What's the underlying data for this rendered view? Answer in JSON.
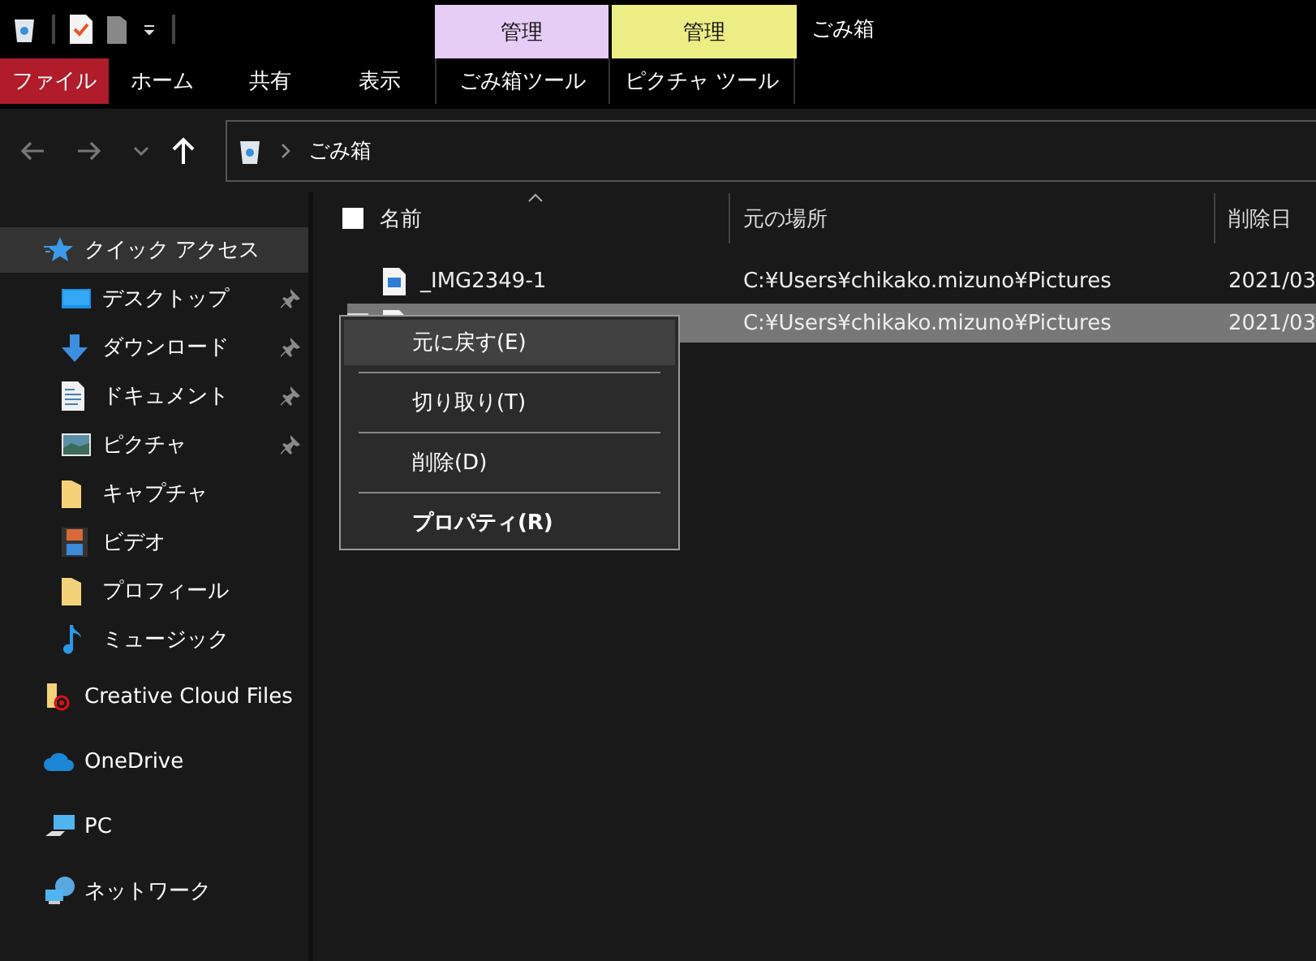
{
  "window": {
    "title": "ごみ箱"
  },
  "context_tabs": [
    {
      "label": "管理",
      "color": "#e6cdf5"
    },
    {
      "label": "管理",
      "color": "#eded86"
    }
  ],
  "ribbon_tabs": [
    {
      "label": "ファイル",
      "kind": "file"
    },
    {
      "label": "ホーム",
      "kind": "tab"
    },
    {
      "label": "共有",
      "kind": "tab"
    },
    {
      "label": "表示",
      "kind": "tab"
    },
    {
      "label": "ごみ箱ツール",
      "kind": "context"
    },
    {
      "label": "ピクチャ ツール",
      "kind": "context"
    }
  ],
  "address_bar": {
    "path": "ごみ箱"
  },
  "sidebar": {
    "items": [
      {
        "label": "クイック アクセス",
        "kind": "star",
        "selected": true,
        "children": [
          {
            "label": "デスクトップ",
            "kind": "desktop",
            "pinned": true,
            "selected": false
          },
          {
            "label": "ダウンロード",
            "kind": "download",
            "pinned": true,
            "selected": false
          },
          {
            "label": "ドキュメント",
            "kind": "document",
            "pinned": true,
            "selected": false
          },
          {
            "label": "ピクチャ",
            "kind": "pictures",
            "pinned": true,
            "selected": false
          },
          {
            "label": "キャプチャ",
            "kind": "folder",
            "pinned": false,
            "selected": false
          },
          {
            "label": "ビデオ",
            "kind": "video",
            "pinned": false,
            "selected": false
          },
          {
            "label": "プロフィール",
            "kind": "folder",
            "pinned": false,
            "selected": false
          },
          {
            "label": "ミュージック",
            "kind": "music",
            "pinned": false,
            "selected": false
          }
        ]
      },
      {
        "label": "Creative Cloud Files",
        "kind": "cc",
        "selected": false
      },
      {
        "label": "OneDrive",
        "kind": "cloud",
        "selected": false
      },
      {
        "label": "PC",
        "kind": "pc",
        "selected": false
      },
      {
        "label": "ネットワーク",
        "kind": "network",
        "selected": false
      }
    ]
  },
  "table": {
    "select_all": {
      "checked": false
    },
    "columns": [
      {
        "label": "名前",
        "sorted": true
      },
      {
        "label": "元の場所",
        "sorted": false
      },
      {
        "label": "削除日",
        "sorted": false
      }
    ],
    "rows": [
      {
        "name": "_IMG2349-1",
        "location": "C:¥Users¥chikako.mizuno¥Pictures",
        "deleted": "2021/03",
        "selected": false
      },
      {
        "location": "C:¥Users¥chikako.mizuno¥Pictures",
        "deleted": "2021/03",
        "selected": true
      }
    ]
  },
  "context_menu": {
    "items": [
      {
        "label": "元に戻す(E)",
        "selected": true,
        "default": false
      },
      {
        "label": "切り取り(T)",
        "selected": false,
        "default": false
      },
      {
        "label": "削除(D)",
        "selected": false,
        "default": false
      },
      {
        "label": "プロパティ(R)",
        "selected": false,
        "default": true
      }
    ]
  }
}
